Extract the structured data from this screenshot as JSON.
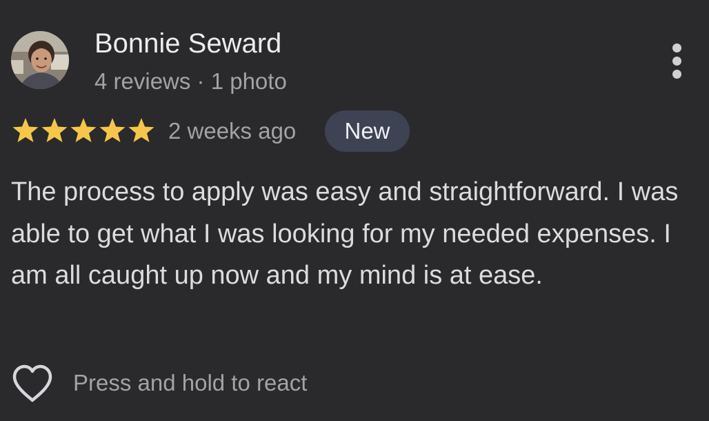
{
  "review": {
    "reviewer_name": "Bonnie Seward",
    "reviewer_meta": "4 reviews · 1 photo",
    "rating": 5,
    "rating_max": 5,
    "time_ago": "2 weeks ago",
    "badge": "New",
    "text": "The process to apply was easy and straightforward. I was able to get what I was looking for my needed expenses. I am all caught up now and my mind is at ease.",
    "react_prompt": "Press and hold to react"
  },
  "icons": {
    "star": "star-icon",
    "more": "more-vert-icon",
    "heart": "heart-outline-icon"
  },
  "colors": {
    "background": "#2a2a2c",
    "star": "#f6c64a",
    "badge_bg": "#3d4352",
    "primary_text": "#ececec",
    "secondary_text": "#a3a3a6"
  }
}
